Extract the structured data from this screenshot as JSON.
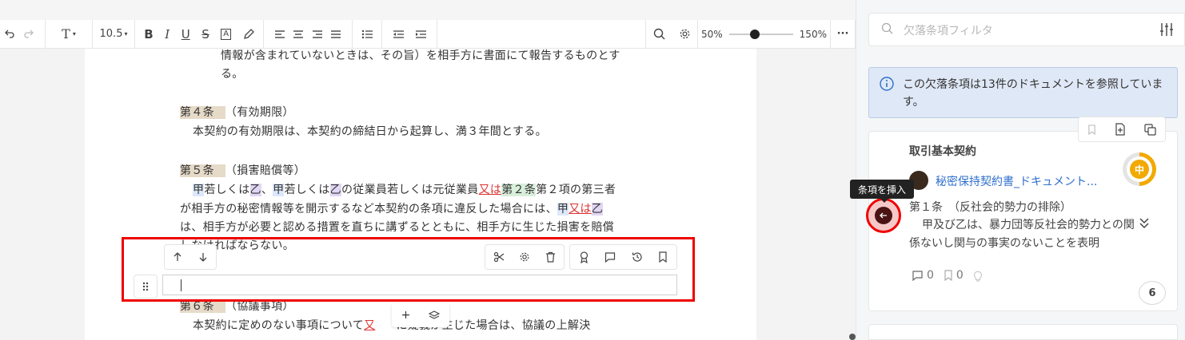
{
  "toolbar": {
    "undo_icon": "undo-icon",
    "redo_icon": "redo-icon",
    "text_style": "T",
    "font_size": "10.5",
    "bold": "B",
    "italic": "I",
    "underline": "U",
    "strike": "S",
    "text_box": "A",
    "zoom_min": "50%",
    "zoom_max": "150%",
    "zoom_level": 0.4
  },
  "document": {
    "line1": "情報が含まれていないときは、その旨）を相手方に書面にて報告するものとす",
    "line2": "る。",
    "art4_heading": "第４条",
    "art4_title": "（有効期限）",
    "art4_body": "本契約の有効期限は、本契約の締結日から起算し、満３年間とする。",
    "art5_heading": "第５条",
    "art5_title": "（損害賠償等）",
    "art5_l1_a": "甲",
    "art5_l1_b": "若しくは",
    "art5_l1_c": "乙",
    "art5_l1_d": "、",
    "art5_l1_e": "甲",
    "art5_l1_f": "若しくは",
    "art5_l1_g": "乙",
    "art5_l1_h": "の従業員若しくは元従業員",
    "art5_l1_i": "又は",
    "art5_l1_j": "第２条",
    "art5_l1_k": "第２項の第三者",
    "art5_l2_a": "が相手方の秘密情報等を開示するなど本契約の条項に違反した場合には、",
    "art5_l2_b": "甲",
    "art5_l2_c": "又は",
    "art5_l2_d": "乙",
    "art5_l3": "は、相手方が必要と認める措置を直ちに講ずるとともに、相手方に生じた損害を賠償",
    "art5_l4": "しなければならない。",
    "art6_heading": "第６条",
    "art6_title": "（協議事項）",
    "art6_l1_a": "本契約に定めのない事項について",
    "art6_l1_b": "又",
    "art6_l1_c": "に疑義が生じた場合は、協議の上解決"
  },
  "block_editor": {
    "input_value": ""
  },
  "panel": {
    "filter_placeholder": "欠落条項フィルタ",
    "info_text": "この欠落条項は13件のドキュメントを参照しています。",
    "card_title": "取引基本契約",
    "doc_link": "秘密保持契約書_ドキュメント...",
    "priority": "中",
    "clause_title": "第１条　（反社会的勢力の排除）",
    "clause_body": "甲及び乙は、暴力団等反社会的勢力との関係ないし関与の事実のないことを表明",
    "comments": "0",
    "bookmarks": "0",
    "count": "6",
    "tooltip": "条項を挿入"
  },
  "colors": {
    "accent_red": "#e00000",
    "link_blue": "#2f6fcc",
    "priority_orange": "#f2a900"
  }
}
